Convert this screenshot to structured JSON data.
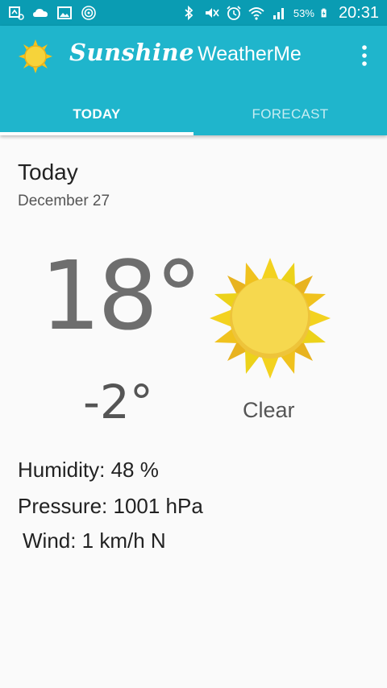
{
  "status_bar": {
    "battery": "53%",
    "time": "20:31",
    "icons": [
      "notification-icon",
      "cloud-icon",
      "image-icon",
      "target-icon",
      "bluetooth-icon",
      "mute-icon",
      "alarm-icon",
      "wifi-icon",
      "signal-icon",
      "battery-charging-icon"
    ]
  },
  "app_bar": {
    "brand_script": "Sunshine",
    "brand_rest": "WeatherMe",
    "logo_icon": "sun-icon",
    "menu_icon": "overflow-menu-icon",
    "color": "#1fb5cc"
  },
  "tabs": [
    {
      "label": "TODAY",
      "active": true
    },
    {
      "label": "FORECAST",
      "active": false
    }
  ],
  "weather": {
    "day": "Today",
    "date": "December 27",
    "high": "18°",
    "low": "-2°",
    "condition": "Clear",
    "condition_icon": "sun-icon",
    "humidity": "Humidity: 48 %",
    "pressure": "Pressure: 1001 hPa",
    "wind": "Wind: 1 km/h N"
  }
}
